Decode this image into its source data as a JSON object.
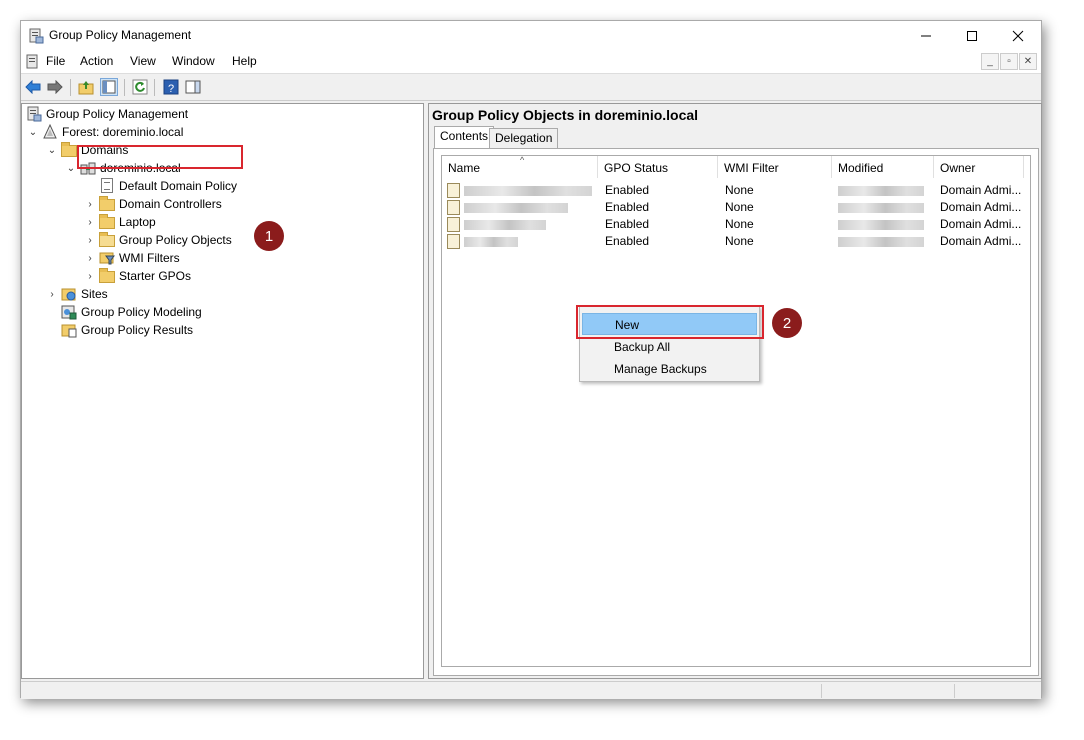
{
  "window": {
    "title": "Group Policy Management"
  },
  "menu": [
    "File",
    "Action",
    "View",
    "Window",
    "Help"
  ],
  "tree": {
    "root": "Group Policy Management",
    "forest": "Forest: doreminio.local",
    "domains": "Domains",
    "domain": "doreminio.local",
    "default_policy": "Default Domain Policy",
    "domain_controllers": "Domain Controllers",
    "laptop": "Laptop",
    "gpo": "Group Policy Objects",
    "wmi": "WMI Filters",
    "starter": "Starter GPOs",
    "sites": "Sites",
    "modeling": "Group Policy Modeling",
    "results": "Group Policy Results"
  },
  "right": {
    "title": "Group Policy Objects in doreminio.local",
    "tabs": [
      "Contents",
      "Delegation"
    ],
    "columns": [
      "Name",
      "GPO Status",
      "WMI Filter",
      "Modified",
      "Owner"
    ],
    "rows": [
      {
        "status": "Enabled",
        "wmi": "None",
        "owner": "Domain Admi..."
      },
      {
        "status": "Enabled",
        "wmi": "None",
        "owner": "Domain Admi..."
      },
      {
        "status": "Enabled",
        "wmi": "None",
        "owner": "Domain Admi..."
      },
      {
        "status": "Enabled",
        "wmi": "None",
        "owner": "Domain Admi..."
      }
    ]
  },
  "context_menu": [
    "New",
    "Backup All",
    "Manage Backups"
  ],
  "badges": [
    "1",
    "2"
  ],
  "colors": {
    "highlight_red": "#d9262e",
    "badge": "#8b1c1c",
    "menu_selection": "#91c9f7"
  }
}
